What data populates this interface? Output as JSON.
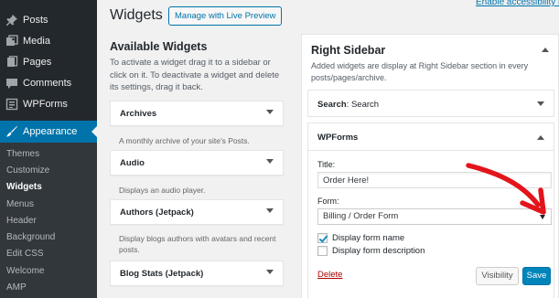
{
  "admin_menu": {
    "items": [
      {
        "label": "Posts",
        "icon": "pushpin-icon"
      },
      {
        "label": "Media",
        "icon": "media-icon"
      },
      {
        "label": "Pages",
        "icon": "pages-icon"
      },
      {
        "label": "Comments",
        "icon": "comment-icon"
      },
      {
        "label": "WPForms",
        "icon": "wpforms-icon"
      }
    ],
    "active": {
      "label": "Appearance",
      "icon": "paintbrush-icon"
    },
    "submenu": [
      "Themes",
      "Customize",
      "Widgets",
      "Menus",
      "Header",
      "Background",
      "Edit CSS",
      "Welcome",
      "AMP"
    ],
    "current_submenu": "Widgets"
  },
  "header": {
    "title": "Widgets",
    "live_preview_label": "Manage with Live Preview",
    "accessibility_link": "Enable accessibility mode"
  },
  "available_widgets": {
    "title": "Available Widgets",
    "description": "To activate a widget drag it to a sidebar or click on it. To deactivate a widget and delete its settings, drag it back.",
    "widgets": [
      {
        "title": "Archives",
        "description": "A monthly archive of your site's Posts."
      },
      {
        "title": "Audio",
        "description": "Displays an audio player."
      },
      {
        "title": "Authors (Jetpack)",
        "description": "Display blogs authors with avatars and recent posts."
      },
      {
        "title": "Blog Stats (Jetpack)",
        "description": ""
      }
    ]
  },
  "right_sidebar": {
    "title": "Right Sidebar",
    "description": "Added widgets are display at Right Sidebar section in every posts/pages/archive.",
    "search_widget": {
      "prefix": "Search",
      "suffix": ": Search"
    },
    "wpforms_widget": {
      "title": "WPForms",
      "title_label": "Title:",
      "title_value": "Order Here!",
      "form_label": "Form:",
      "form_selected": "Billing / Order Form",
      "checkbox_name": {
        "label": "Display form name",
        "checked": true
      },
      "checkbox_desc": {
        "label": "Display form description",
        "checked": false
      },
      "delete_label": "Delete",
      "visibility_label": "Visibility",
      "save_label": "Save"
    }
  },
  "colors": {
    "sidebar_bg": "#23282d",
    "submenu_bg": "#32373c",
    "active_bg": "#0073aa",
    "primary_button": "#0085ba",
    "delete_red": "#a00",
    "annotation_red": "#e3141b"
  }
}
